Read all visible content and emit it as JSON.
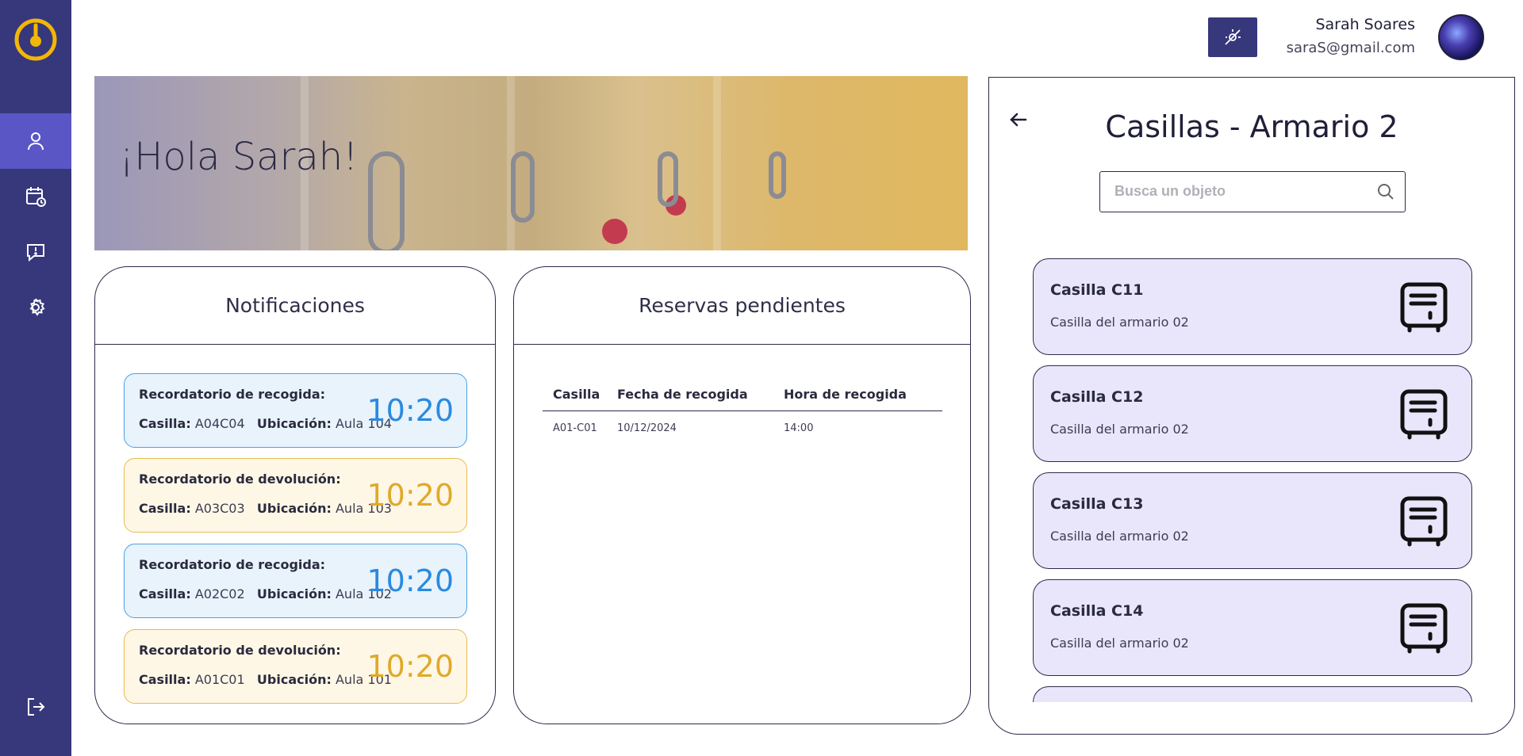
{
  "header": {
    "user_name": "Sarah Soares",
    "user_email": "saraS@gmail.com"
  },
  "banner": {
    "greeting": "¡Hola Sarah!"
  },
  "notifications": {
    "title": "Notificaciones",
    "labels": {
      "casilla": "Casilla:",
      "ubicacion": "Ubicación:"
    },
    "items": [
      {
        "title": "Recordatorio de recogida:",
        "casilla": "A04C04",
        "ubicacion": "Aula 104",
        "time": "10:20",
        "kind": "blue"
      },
      {
        "title": "Recordatorio de devolución:",
        "casilla": "A03C03",
        "ubicacion": "Aula 103",
        "time": "10:20",
        "kind": "yellow"
      },
      {
        "title": "Recordatorio de recogida:",
        "casilla": "A02C02",
        "ubicacion": "Aula 102",
        "time": "10:20",
        "kind": "blue"
      },
      {
        "title": "Recordatorio de devolución:",
        "casilla": "A01C01",
        "ubicacion": "Aula 101",
        "time": "10:20",
        "kind": "yellow"
      }
    ]
  },
  "reservations": {
    "title": "Reservas pendientes",
    "columns": [
      "Casilla",
      "Fecha de recogida",
      "Hora de recogida"
    ],
    "rows": [
      [
        "A01-C01",
        "10/12/2024",
        "14:00"
      ]
    ]
  },
  "lockers": {
    "title": "Casillas - Armario 2",
    "search_placeholder": "Busca un objeto",
    "items": [
      {
        "name": "Casilla C11",
        "desc": "Casilla del armario 02"
      },
      {
        "name": "Casilla C12",
        "desc": "Casilla del armario 02"
      },
      {
        "name": "Casilla C13",
        "desc": "Casilla del armario 02"
      },
      {
        "name": "Casilla C14",
        "desc": "Casilla del armario 02"
      }
    ]
  },
  "colors": {
    "sidebar": "#37377c",
    "sidebar_active": "#5a56c6",
    "logo": "#f2b705",
    "locker_card": "#e9e6fb",
    "notif_blue": "#2a8ae0",
    "notif_yellow": "#e0a92a"
  },
  "icons": {
    "sidebar": [
      "user-icon",
      "calendar-clock-icon",
      "chat-alert-icon",
      "gear-icon"
    ],
    "logout": "logout-icon",
    "theme_toggle": "theme-toggle-icon",
    "back": "arrow-left-icon",
    "search": "search-icon",
    "locker": "locker-icon"
  }
}
